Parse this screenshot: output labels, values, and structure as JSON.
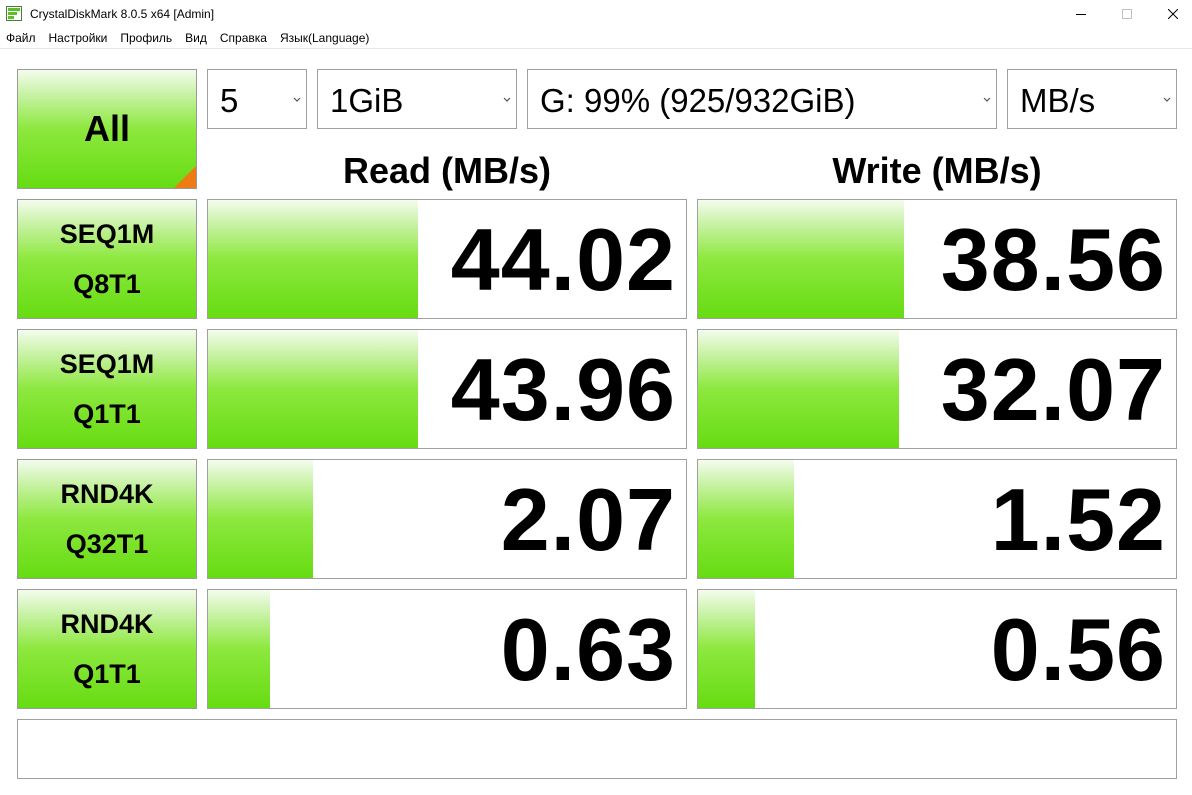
{
  "window": {
    "title": "CrystalDiskMark 8.0.5 x64 [Admin]",
    "app_icon": "crystaldiskmark-app-icon",
    "controls": [
      "minimize-icon",
      "maximize-icon",
      "close-icon"
    ]
  },
  "menu": [
    "Файл",
    "Настройки",
    "Профиль",
    "Вид",
    "Справка",
    "Язык(Language)"
  ],
  "all_button": {
    "label": "All"
  },
  "settings": {
    "runs": "5",
    "size": "1GiB",
    "drive": "G: 99% (925/932GiB)",
    "unit": "MB/s"
  },
  "headers": {
    "read": "Read (MB/s)",
    "write": "Write (MB/s)"
  },
  "rows": [
    {
      "line1": "SEQ1M",
      "line2": "Q8T1",
      "read": "44.02",
      "write": "38.56",
      "read_fill": 0.44,
      "write_fill": 0.43
    },
    {
      "line1": "SEQ1M",
      "line2": "Q1T1",
      "read": "43.96",
      "write": "32.07",
      "read_fill": 0.44,
      "write_fill": 0.42
    },
    {
      "line1": "RND4K",
      "line2": "Q32T1",
      "read": "2.07",
      "write": "1.52",
      "read_fill": 0.22,
      "write_fill": 0.2
    },
    {
      "line1": "RND4K",
      "line2": "Q1T1",
      "read": "0.63",
      "write": "0.56",
      "read_fill": 0.13,
      "write_fill": 0.12
    }
  ],
  "comment": "",
  "colors": {
    "accent_green": "#66dc12",
    "corner_orange": "#f07b14"
  }
}
